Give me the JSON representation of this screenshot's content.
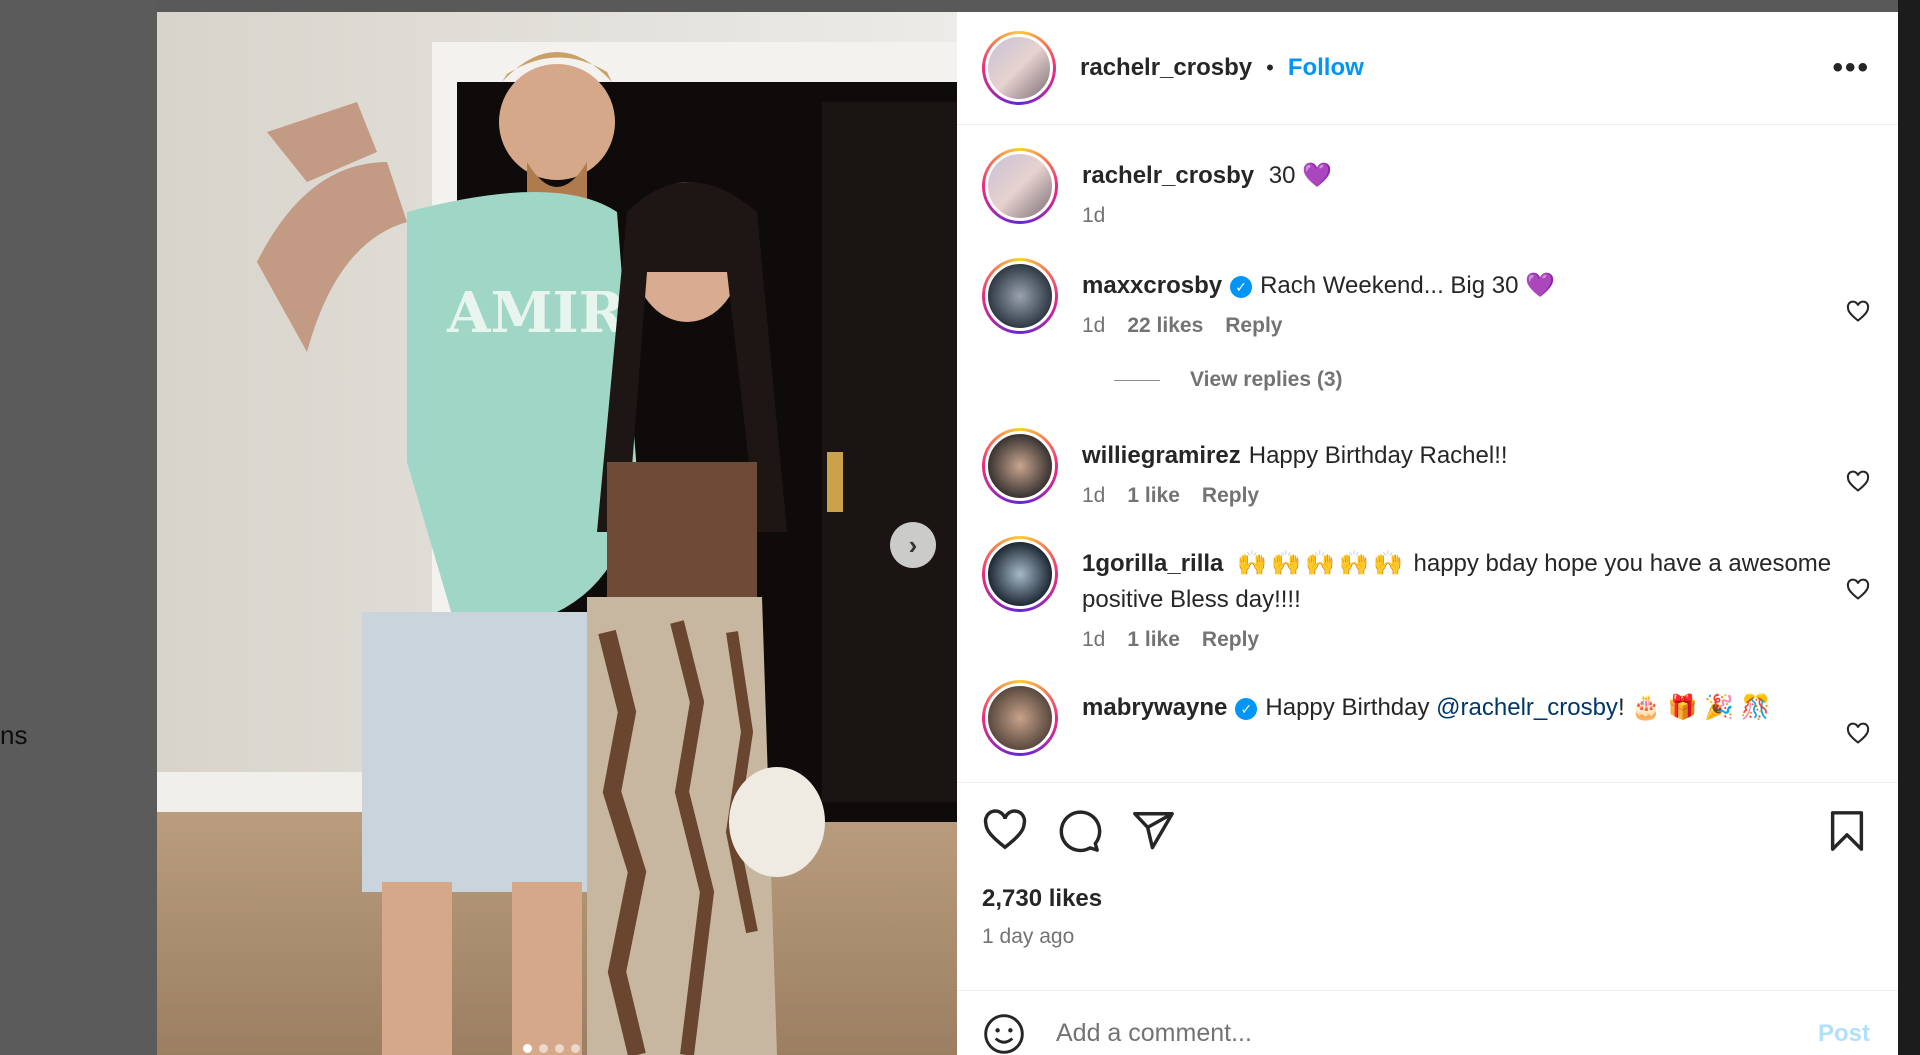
{
  "backdrop": {
    "peek_text": "ns"
  },
  "post": {
    "author": "rachelr_crosby",
    "follow_label": "Follow",
    "separator": "•",
    "more_label": "•••",
    "next_label": "›",
    "caption": {
      "username": "rachelr_crosby",
      "text": "30",
      "emoji": "💜",
      "time": "1d"
    },
    "comments": [
      {
        "username": "maxxcrosby",
        "verified": true,
        "text": "Rach Weekend... Big 30 💜",
        "time": "1d",
        "likes": "22 likes",
        "reply": "Reply"
      },
      {
        "username": "williegramirez",
        "verified": false,
        "text": "Happy Birthday Rachel!!",
        "time": "1d",
        "likes": "1 like",
        "reply": "Reply"
      },
      {
        "username": "1gorilla_rilla",
        "verified": false,
        "emojis": "🙌🙌🙌🙌🙌",
        "text": "happy bday hope you have a awesome positive Bless day!!!!",
        "time": "1d",
        "likes": "1 like",
        "reply": "Reply"
      },
      {
        "username": "mabrywayne",
        "verified": true,
        "text": "Happy Birthday ",
        "mention": "@rachelr_crosby",
        "text_after": "! 🎂 🎁 🎉 🎊"
      }
    ],
    "view_replies": "View replies (3)",
    "likes_count": "2,730 likes",
    "time_ago": "1 day ago",
    "comment_placeholder": "Add a comment...",
    "post_label": "Post",
    "carousel": {
      "count": 4,
      "active": 0
    }
  },
  "colors": {
    "link": "#0095f6",
    "mention": "#00376b",
    "text": "#262626",
    "muted": "#737373"
  },
  "icons": [
    "heart-icon",
    "comment-icon",
    "share-icon",
    "bookmark-icon",
    "emoji-icon",
    "more-icon",
    "chevron-right-icon",
    "verified-icon"
  ]
}
